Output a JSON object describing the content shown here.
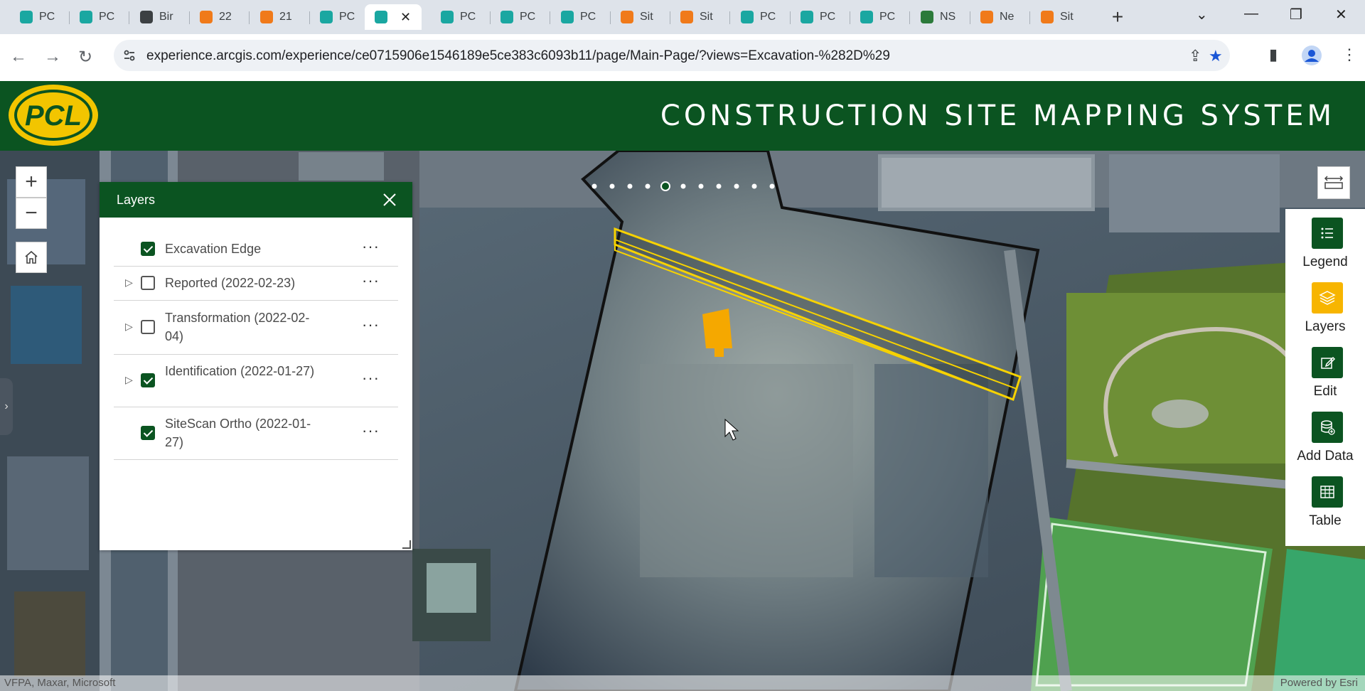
{
  "browser": {
    "tabs": [
      {
        "label": "PC",
        "icon": "shield-icon",
        "color": "#1aa7a1"
      },
      {
        "label": "PC",
        "icon": "shield-icon",
        "color": "#1aa7a1"
      },
      {
        "label": "Bir",
        "icon": "globe-icon",
        "color": "#3c4043"
      },
      {
        "label": "22",
        "icon": "sitescan-icon",
        "color": "#f07a1a"
      },
      {
        "label": "21",
        "icon": "sitescan-icon",
        "color": "#f07a1a"
      },
      {
        "label": "PC",
        "icon": "shield-icon",
        "color": "#1aa7a1"
      },
      {
        "label": "",
        "icon": "shield-icon",
        "color": "#1aa7a1",
        "active": true
      },
      {
        "label": "PC",
        "icon": "shield-icon",
        "color": "#1aa7a1"
      },
      {
        "label": "PC",
        "icon": "shield-icon",
        "color": "#1aa7a1"
      },
      {
        "label": "PC",
        "icon": "shield-icon",
        "color": "#1aa7a1"
      },
      {
        "label": "Sit",
        "icon": "sitescan-icon",
        "color": "#f07a1a"
      },
      {
        "label": "Sit",
        "icon": "sitescan-icon",
        "color": "#f07a1a"
      },
      {
        "label": "PC",
        "icon": "shield-icon",
        "color": "#1aa7a1"
      },
      {
        "label": "PC",
        "icon": "shield-icon",
        "color": "#1aa7a1"
      },
      {
        "label": "PC",
        "icon": "shield-icon",
        "color": "#1aa7a1"
      },
      {
        "label": "NS",
        "icon": "earth-icon",
        "color": "#2b7a3a"
      },
      {
        "label": "Ne",
        "icon": "news-icon",
        "color": "#f07a1a"
      },
      {
        "label": "Sit",
        "icon": "sitescan-icon",
        "color": "#f07a1a"
      }
    ],
    "url": "experience.arcgis.com/experience/ce0715906e1546189e5ce383c6093b11/page/Main-Page/?views=Excavation-%282D%29"
  },
  "app": {
    "logo_text": "PCL",
    "title": "CONSTRUCTION SITE MAPPING SYSTEM"
  },
  "layers_panel": {
    "title": "Layers",
    "layers": [
      {
        "name": "Excavation Edge",
        "checked": true,
        "expandable": false,
        "more": "···"
      },
      {
        "name": "Reported (2022-02-23)",
        "checked": false,
        "expandable": true,
        "more": "···"
      },
      {
        "name": "Transformation (2022-02-04)",
        "checked": false,
        "expandable": true,
        "more": "···"
      },
      {
        "name": "Identification (2022-01-27)",
        "checked": true,
        "expandable": true,
        "more": "···"
      },
      {
        "name": "SiteScan Ortho (2022-01-27)",
        "checked": true,
        "expandable": false,
        "more": "···"
      }
    ]
  },
  "widgets": [
    {
      "label": "Legend",
      "icon": "legend-icon",
      "selected": false
    },
    {
      "label": "Layers",
      "icon": "layers-icon",
      "selected": true
    },
    {
      "label": "Edit",
      "icon": "edit-icon",
      "selected": false
    },
    {
      "label": "Add Data",
      "icon": "add-data-icon",
      "selected": false
    },
    {
      "label": "Table",
      "icon": "table-icon",
      "selected": false
    }
  ],
  "map": {
    "attribution_left": "VFPA, Maxar, Microsoft",
    "attribution_right": "Powered by Esri"
  },
  "colors": {
    "brand_green": "#0b5421",
    "accent_yellow": "#f7b500",
    "logo_yellow": "#f2c500"
  }
}
